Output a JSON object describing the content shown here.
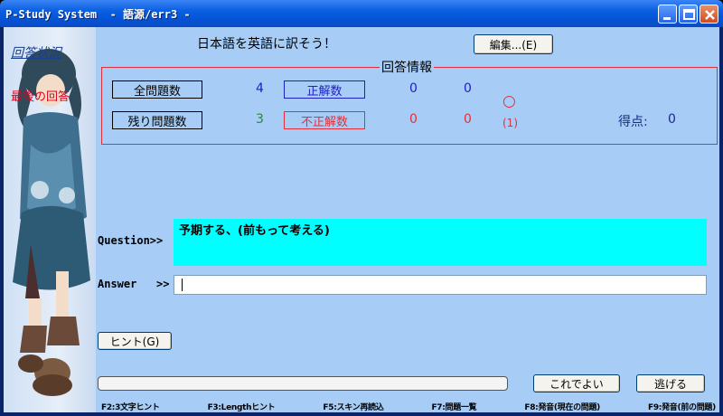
{
  "window": {
    "title": "P-Study System  - 語源/err3 -"
  },
  "banner": {
    "title": "回答状況",
    "subtitle": "最後の回答"
  },
  "main": {
    "heading": "日本語を英語に訳そう！",
    "edit_button": "編集...(E)"
  },
  "answer_info": {
    "legend": "回答情報",
    "total_label": "全問題数",
    "total_value": "4",
    "correct_label": "正解数",
    "correct_value_a": "0",
    "correct_value_b": "0",
    "remaining_label": "残り問題数",
    "remaining_value": "3",
    "incorrect_label": "不正解数",
    "incorrect_value_a": "0",
    "incorrect_value_b": "0",
    "mark_circle": "○",
    "mark_count": "(1)",
    "score_label": "得点:",
    "score_value": "0"
  },
  "question": {
    "label": "Question>>",
    "text": "予期する、(前もって考える)"
  },
  "answer": {
    "label": "Answer   >>",
    "value": ""
  },
  "buttons": {
    "hint": "ヒント(G)",
    "confirm": "これでよい",
    "escape": "逃げる"
  },
  "progress": {
    "value": 0
  },
  "function_keys": [
    "F2:3文字ヒント",
    "F3:Lengthヒント",
    "F5:スキン再読込",
    "F7:問題一覧",
    "F8:発音(現在の問題)",
    "F9:発音(前の問題)"
  ],
  "colors": {
    "client_bg": "#a7cdf6",
    "question_bg": "#00ffff",
    "accent_red": "#e0303c",
    "accent_blue": "#2020c0"
  }
}
